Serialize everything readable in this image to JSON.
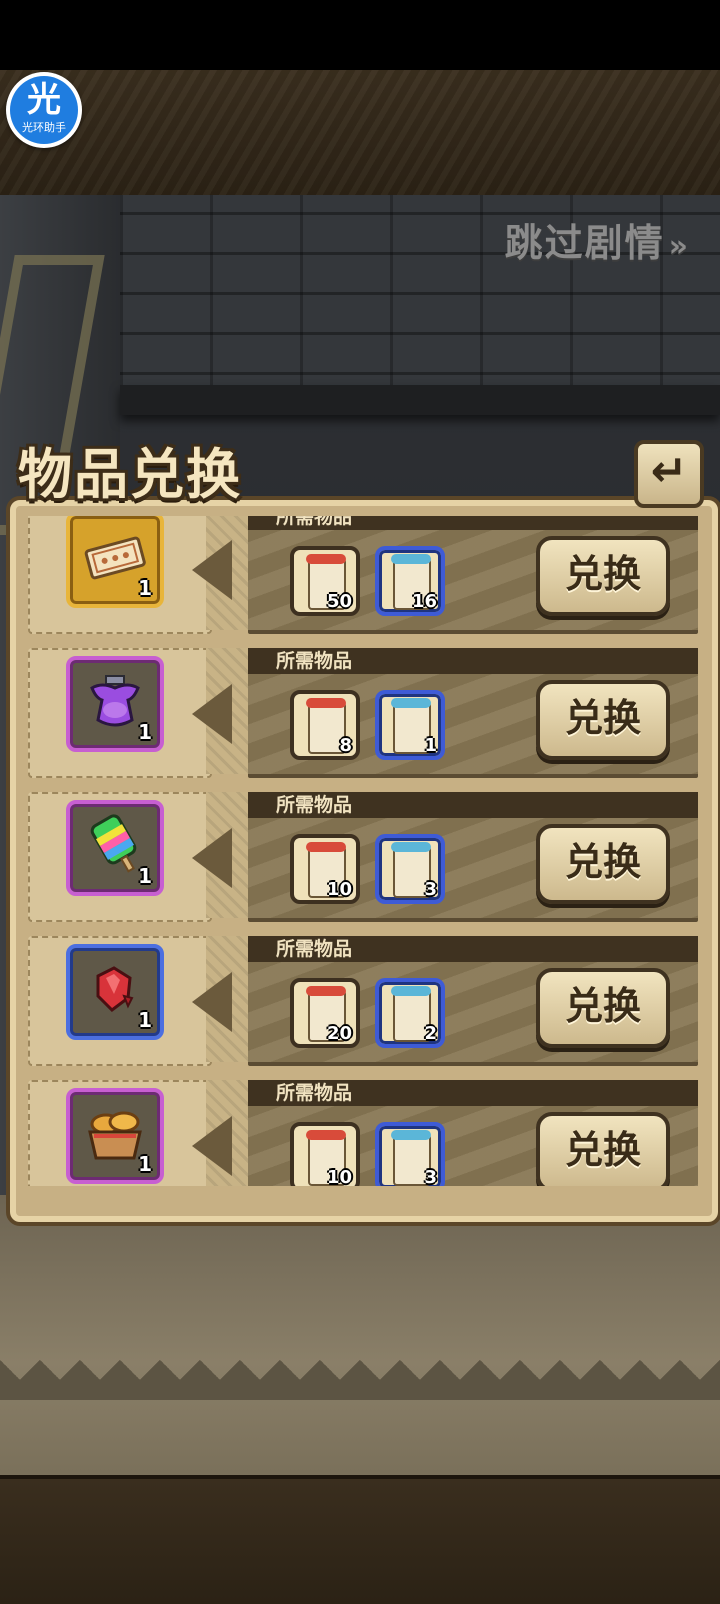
{
  "helper": {
    "char": "光",
    "label": "光环助手"
  },
  "skip": {
    "label": "跳过剧情",
    "arrow": "»"
  },
  "header": {
    "title": "物品兑换",
    "back_icon": "↵"
  },
  "colors": {
    "gold_frame": "#e8b53a",
    "purple_frame": "#c75fd1",
    "blue_frame": "#4c6fe0"
  },
  "rows": [
    {
      "required_label": "所需物品",
      "item_icon": "ticket-icon",
      "item_qty": "1",
      "costs": [
        {
          "icon": "red-scroll-icon",
          "qty": "50"
        },
        {
          "icon": "blue-scroll-icon",
          "qty": "16"
        }
      ],
      "button": "兑换"
    },
    {
      "required_label": "所需物品",
      "item_icon": "potion-vase-icon",
      "item_qty": "1",
      "costs": [
        {
          "icon": "red-scroll-icon",
          "qty": "8"
        },
        {
          "icon": "blue-scroll-icon",
          "qty": "1"
        }
      ],
      "button": "兑换"
    },
    {
      "required_label": "所需物品",
      "item_icon": "rainbow-popsicle-icon",
      "item_qty": "1",
      "costs": [
        {
          "icon": "red-scroll-icon",
          "qty": "10"
        },
        {
          "icon": "blue-scroll-icon",
          "qty": "3"
        }
      ],
      "button": "兑换"
    },
    {
      "required_label": "所需物品",
      "item_icon": "red-crystal-icon",
      "item_qty": "1",
      "costs": [
        {
          "icon": "red-scroll-icon",
          "qty": "20"
        },
        {
          "icon": "blue-scroll-icon",
          "qty": "2"
        }
      ],
      "button": "兑换"
    },
    {
      "required_label": "所需物品",
      "item_icon": "bread-basket-icon",
      "item_qty": "1",
      "costs": [
        {
          "icon": "red-scroll-icon",
          "qty": "10"
        },
        {
          "icon": "blue-scroll-icon",
          "qty": "3"
        }
      ],
      "button": "兑换"
    }
  ]
}
